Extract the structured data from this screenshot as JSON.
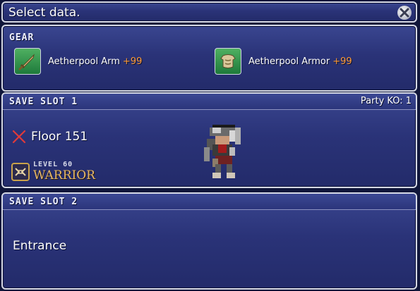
{
  "title_bar": {
    "text": "Select data.",
    "close_icon": "close-icon"
  },
  "gear": {
    "label": "GEAR",
    "items": [
      {
        "name": "Aetherpool Arm",
        "bonus": "+99",
        "icon": "sword-icon"
      },
      {
        "name": "Aetherpool Armor",
        "bonus": "+99",
        "icon": "armor-icon"
      }
    ]
  },
  "slots": [
    {
      "label": "SAVE SLOT 1",
      "party_ko": "Party KO: 1",
      "floor": "Floor 151",
      "floor_icon": "x-mark-icon",
      "level": "LEVEL 60",
      "job": "WARRIOR",
      "job_icon": "warrior-emblem-icon"
    },
    {
      "label": "SAVE SLOT 2",
      "location": "Entrance"
    }
  ],
  "colors": {
    "panel_bg": "#2a3378",
    "border": "#d6d9e6",
    "bonus": "#ff9d3a",
    "job_name": "#e7b96a",
    "x_mark": "#e03a3a"
  }
}
